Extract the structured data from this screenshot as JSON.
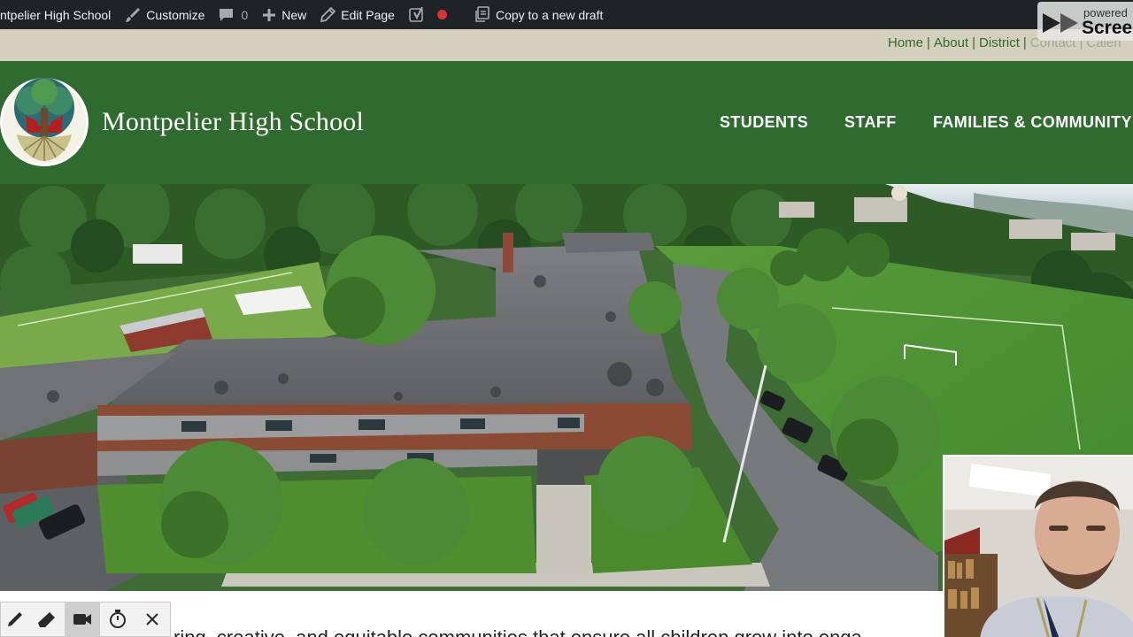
{
  "admin_bar": {
    "site_name": "ntpelier High School",
    "customize": "Customize",
    "comments_count": "0",
    "new_label": "New",
    "edit_page": "Edit Page",
    "copy_draft": "Copy to a new draft"
  },
  "watermark": {
    "line1": "powered",
    "line2": "Scree"
  },
  "util_nav": {
    "items": [
      "Home",
      "About",
      "District",
      "Contact",
      "Calen"
    ],
    "separator": "|"
  },
  "header": {
    "title": "Montpelier High School",
    "nav": [
      "STUDENTS",
      "STAFF",
      "FAMILIES & COMMUNITY"
    ]
  },
  "mission": {
    "text": "ring, creative, and equitable communities that ensure all children grow into enga"
  },
  "colors": {
    "admin_bar": "#1d2327",
    "util_bar": "#d5cfbd",
    "header_green": "#2f6a2e",
    "link_green": "#2e6b2e"
  },
  "icons": {
    "customize": "brush-icon",
    "comments": "comment-icon",
    "new": "plus-icon",
    "edit": "pencil-icon",
    "seo": "yoast-icon",
    "copy": "copy-icon",
    "rec_tools": [
      "pen-icon",
      "eraser-icon",
      "camera-icon",
      "timer-icon",
      "close-icon"
    ]
  }
}
